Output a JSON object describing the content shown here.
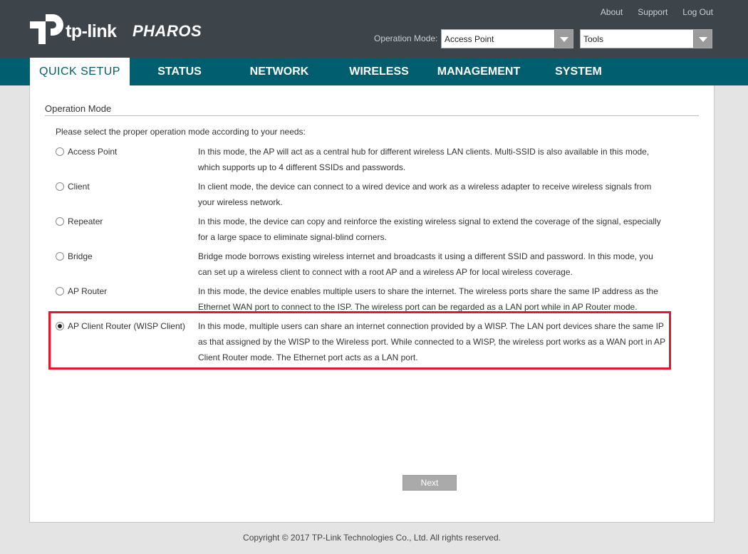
{
  "brand": {
    "logo_text": "tp-link",
    "product": "PHAROS"
  },
  "top_links": [
    "About",
    "Support",
    "Log Out"
  ],
  "operation_mode": {
    "label": "Operation Mode:",
    "value": "Access Point"
  },
  "tools_select": {
    "value": "Tools"
  },
  "nav": {
    "tabs": [
      {
        "label": "QUICK SETUP",
        "active": true
      },
      {
        "label": "STATUS",
        "active": false
      },
      {
        "label": "NETWORK",
        "active": false
      },
      {
        "label": "WIRELESS",
        "active": false
      },
      {
        "label": "MANAGEMENT",
        "active": false
      },
      {
        "label": "SYSTEM",
        "active": false
      }
    ]
  },
  "main": {
    "section_title": "Operation Mode",
    "intro": "Please select the proper operation mode according to your needs:",
    "options": [
      {
        "label": "Access Point",
        "checked": false,
        "description": "In this mode, the AP will act as a central hub for different wireless LAN clients. Multi-SSID is also available in this mode, which supports up to 4 different SSIDs and passwords."
      },
      {
        "label": "Client",
        "checked": false,
        "description": "In client mode, the device can connect to a wired device and work as a wireless adapter to receive wireless signals from your wireless network."
      },
      {
        "label": "Repeater",
        "checked": false,
        "description": "In this mode, the device can copy and reinforce the existing wireless signal to extend the coverage of the signal, especially for a large space to eliminate signal-blind corners."
      },
      {
        "label": "Bridge",
        "checked": false,
        "description": "Bridge mode borrows existing wireless internet and broadcasts it using a different SSID and password. In this mode, you can set up a wireless client to connect with a root AP and a wireless AP for local wireless coverage."
      },
      {
        "label": "AP Router",
        "checked": false,
        "description": "In this mode, the device enables multiple users to share the internet. The wireless ports share the same IP address as the Ethernet WAN port to connect to the ISP. The wireless port can be regarded as a LAN port while in AP Router mode."
      },
      {
        "label": "AP Client Router (WISP Client)",
        "checked": true,
        "description": "In this mode, multiple users can share an internet connection provided by a WISP. The LAN port devices share the same IP as that assigned by the WISP to the Wireless port. While connected to a WISP, the wireless port works as a WAN port in AP Client Router mode. The Ethernet port acts as a LAN port."
      }
    ],
    "next_label": "Next"
  },
  "footer": "Copyright © 2017 TP-Link Technologies Co., Ltd. All rights reserved.",
  "colors": {
    "header": "#3d454b",
    "nav": "#005e6e",
    "highlight": "#e2192b"
  }
}
